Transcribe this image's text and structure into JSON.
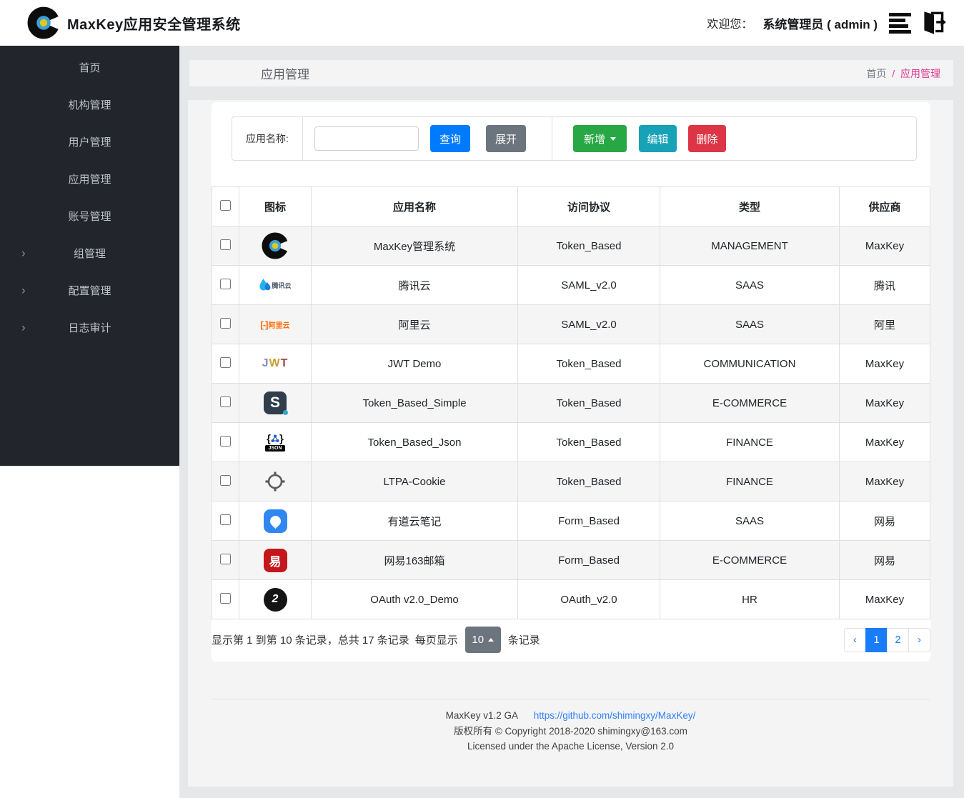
{
  "header": {
    "app_title": "MaxKey应用安全管理系统",
    "welcome_label": "欢迎您：",
    "user_label": "系统管理员 ( admin )"
  },
  "sidebar": {
    "items": [
      {
        "label": "首页",
        "expandable": false
      },
      {
        "label": "机构管理",
        "expandable": false
      },
      {
        "label": "用户管理",
        "expandable": false
      },
      {
        "label": "应用管理",
        "expandable": false
      },
      {
        "label": "账号管理",
        "expandable": false
      },
      {
        "label": "组管理",
        "expandable": true
      },
      {
        "label": "配置管理",
        "expandable": true
      },
      {
        "label": "日志审计",
        "expandable": true
      }
    ],
    "chevron_icon": "›"
  },
  "page": {
    "title": "应用管理",
    "breadcrumb": {
      "home": "首页",
      "separator": "/",
      "current": "应用管理"
    }
  },
  "toolbar": {
    "search_label": "应用名称:",
    "search_value": "",
    "query_button": "查询",
    "expand_button": "展开",
    "add_button": "新增",
    "edit_button": "编辑",
    "delete_button": "删除"
  },
  "table": {
    "columns": [
      "图标",
      "应用名称",
      "访问协议",
      "类型",
      "供应商"
    ],
    "select_all_checked": false,
    "rows": [
      {
        "icon": "maxkey-icon",
        "name": "MaxKey管理系统",
        "protocol": "Token_Based",
        "type": "MANAGEMENT",
        "vendor": "MaxKey",
        "checked": false
      },
      {
        "icon": "tencent-cloud-icon",
        "name": "腾讯云",
        "protocol": "SAML_v2.0",
        "type": "SAAS",
        "vendor": "腾讯",
        "checked": false
      },
      {
        "icon": "aliyun-icon",
        "name": "阿里云",
        "protocol": "SAML_v2.0",
        "type": "SAAS",
        "vendor": "阿里",
        "checked": false
      },
      {
        "icon": "jwt-icon",
        "name": "JWT Demo",
        "protocol": "Token_Based",
        "type": "COMMUNICATION",
        "vendor": "MaxKey",
        "checked": false
      },
      {
        "icon": "simple-s-icon",
        "name": "Token_Based_Simple",
        "protocol": "Token_Based",
        "type": "E-COMMERCE",
        "vendor": "MaxKey",
        "checked": false
      },
      {
        "icon": "json-icon",
        "name": "Token_Based_Json",
        "protocol": "Token_Based",
        "type": "FINANCE",
        "vendor": "MaxKey",
        "checked": false
      },
      {
        "icon": "ltpa-icon",
        "name": "LTPA-Cookie",
        "protocol": "Token_Based",
        "type": "FINANCE",
        "vendor": "MaxKey",
        "checked": false
      },
      {
        "icon": "youdao-icon",
        "name": "有道云笔记",
        "protocol": "Form_Based",
        "type": "SAAS",
        "vendor": "网易",
        "checked": false
      },
      {
        "icon": "netease-163-icon",
        "name": "网易163邮箱",
        "protocol": "Form_Based",
        "type": "E-COMMERCE",
        "vendor": "网易",
        "checked": false
      },
      {
        "icon": "oauth2-icon",
        "name": "OAuth v2.0_Demo",
        "protocol": "OAuth_v2.0",
        "type": "HR",
        "vendor": "MaxKey",
        "checked": false
      }
    ]
  },
  "pagination": {
    "records_summary": "显示第 1 到第 10 条记录，总共 17 条记录",
    "per_page_label": "每页显示",
    "page_size": "10",
    "records_unit": "条记录",
    "prev_icon": "‹",
    "pages": [
      "1",
      "2"
    ],
    "active_page": "1",
    "next_icon": "›"
  },
  "footer": {
    "version": "MaxKey  v1.2 GA",
    "link": "https://github.com/shimingxy/MaxKey/",
    "copyright": "版权所有 © Copyright 2018-2020 shimingxy@163.com",
    "license": "Licensed under the Apache License, Version 2.0"
  },
  "colors": {
    "primary": "#007bff",
    "secondary": "#6c757d",
    "success": "#28a745",
    "info": "#17a2b8",
    "danger": "#dc3545",
    "breadcrumb_active": "#e0368c",
    "sidebar_bg": "#22252b",
    "pagination_active": "#1a7cf8"
  }
}
